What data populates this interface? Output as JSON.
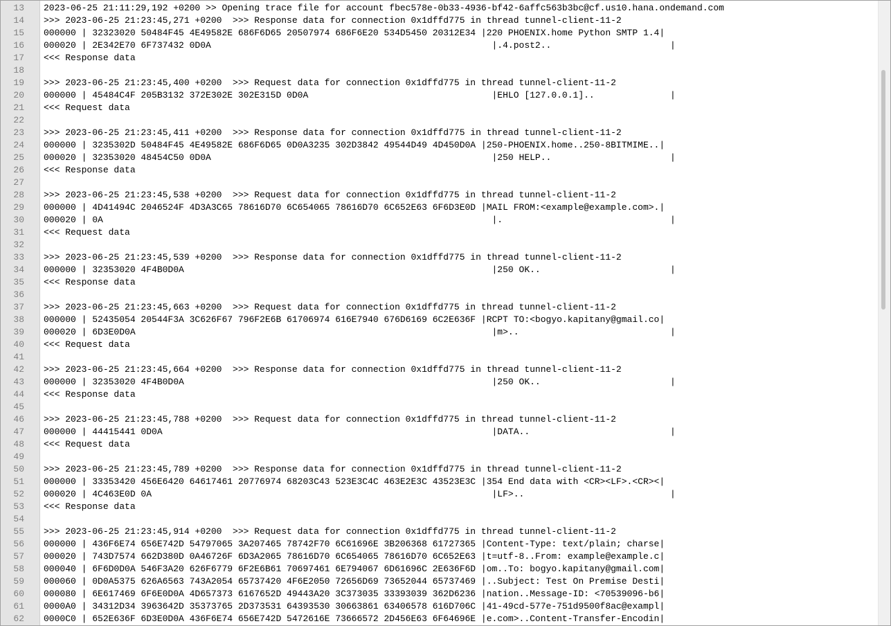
{
  "editor": {
    "lines": [
      {
        "num": "13",
        "text": "2023-06-25 21:11:29,192 +0200 >> Opening trace file for account fbec578e-0b33-4936-bf42-6affc563b3bc@cf.us10.hana.ondemand.com"
      },
      {
        "num": "14",
        "text": ">>> 2023-06-25 21:23:45,271 +0200  >>> Response data for connection 0x1dffd775 in thread tunnel-client-11-2"
      },
      {
        "num": "15",
        "text": "000000 | 32323020 50484F45 4E49582E 686F6D65 20507974 686F6E20 534D5450 20312E34 |220 PHOENIX.home Python SMTP 1.4|"
      },
      {
        "num": "16",
        "text": "000020 | 2E342E70 6F737432 0D0A                                                    |.4.post2..                      |"
      },
      {
        "num": "17",
        "text": "<<< Response data"
      },
      {
        "num": "18",
        "text": ""
      },
      {
        "num": "19",
        "text": ">>> 2023-06-25 21:23:45,400 +0200  >>> Request data for connection 0x1dffd775 in thread tunnel-client-11-2"
      },
      {
        "num": "20",
        "text": "000000 | 45484C4F 205B3132 372E302E 302E315D 0D0A                                  |EHLO [127.0.0.1]..              |"
      },
      {
        "num": "21",
        "text": "<<< Request data"
      },
      {
        "num": "22",
        "text": ""
      },
      {
        "num": "23",
        "text": ">>> 2023-06-25 21:23:45,411 +0200  >>> Response data for connection 0x1dffd775 in thread tunnel-client-11-2"
      },
      {
        "num": "24",
        "text": "000000 | 3235302D 50484F45 4E49582E 686F6D65 0D0A3235 302D3842 49544D49 4D450D0A |250-PHOENIX.home..250-8BITMIME..|"
      },
      {
        "num": "25",
        "text": "000020 | 32353020 48454C50 0D0A                                                    |250 HELP..                      |"
      },
      {
        "num": "26",
        "text": "<<< Response data"
      },
      {
        "num": "27",
        "text": ""
      },
      {
        "num": "28",
        "text": ">>> 2023-06-25 21:23:45,538 +0200  >>> Request data for connection 0x1dffd775 in thread tunnel-client-11-2"
      },
      {
        "num": "29",
        "text": "000000 | 4D41494C 2046524F 4D3A3C65 78616D70 6C654065 78616D70 6C652E63 6F6D3E0D |MAIL FROM:<example@example.com>.|"
      },
      {
        "num": "30",
        "text": "000020 | 0A                                                                        |.                               |"
      },
      {
        "num": "31",
        "text": "<<< Request data"
      },
      {
        "num": "32",
        "text": ""
      },
      {
        "num": "33",
        "text": ">>> 2023-06-25 21:23:45,539 +0200  >>> Response data for connection 0x1dffd775 in thread tunnel-client-11-2"
      },
      {
        "num": "34",
        "text": "000000 | 32353020 4F4B0D0A                                                         |250 OK..                        |"
      },
      {
        "num": "35",
        "text": "<<< Response data"
      },
      {
        "num": "36",
        "text": ""
      },
      {
        "num": "37",
        "text": ">>> 2023-06-25 21:23:45,663 +0200  >>> Request data for connection 0x1dffd775 in thread tunnel-client-11-2"
      },
      {
        "num": "38",
        "text": "000000 | 52435054 20544F3A 3C626F67 796F2E6B 61706974 616E7940 676D6169 6C2E636F |RCPT TO:<bogyo.kapitany@gmail.co|"
      },
      {
        "num": "39",
        "text": "000020 | 6D3E0D0A                                                                  |m>..                            |"
      },
      {
        "num": "40",
        "text": "<<< Request data"
      },
      {
        "num": "41",
        "text": ""
      },
      {
        "num": "42",
        "text": ">>> 2023-06-25 21:23:45,664 +0200  >>> Response data for connection 0x1dffd775 in thread tunnel-client-11-2"
      },
      {
        "num": "43",
        "text": "000000 | 32353020 4F4B0D0A                                                         |250 OK..                        |"
      },
      {
        "num": "44",
        "text": "<<< Response data"
      },
      {
        "num": "45",
        "text": ""
      },
      {
        "num": "46",
        "text": ">>> 2023-06-25 21:23:45,788 +0200  >>> Request data for connection 0x1dffd775 in thread tunnel-client-11-2"
      },
      {
        "num": "47",
        "text": "000000 | 44415441 0D0A                                                             |DATA..                          |"
      },
      {
        "num": "48",
        "text": "<<< Request data"
      },
      {
        "num": "49",
        "text": ""
      },
      {
        "num": "50",
        "text": ">>> 2023-06-25 21:23:45,789 +0200  >>> Response data for connection 0x1dffd775 in thread tunnel-client-11-2"
      },
      {
        "num": "51",
        "text": "000000 | 33353420 456E6420 64617461 20776974 68203C43 523E3C4C 463E2E3C 43523E3C |354 End data with <CR><LF>.<CR><|"
      },
      {
        "num": "52",
        "text": "000020 | 4C463E0D 0A                                                               |LF>..                           |"
      },
      {
        "num": "53",
        "text": "<<< Response data"
      },
      {
        "num": "54",
        "text": ""
      },
      {
        "num": "55",
        "text": ">>> 2023-06-25 21:23:45,914 +0200  >>> Request data for connection 0x1dffd775 in thread tunnel-client-11-2"
      },
      {
        "num": "56",
        "text": "000000 | 436F6E74 656E742D 54797065 3A207465 78742F70 6C61696E 3B206368 61727365 |Content-Type: text/plain; charse|"
      },
      {
        "num": "57",
        "text": "000020 | 743D7574 662D380D 0A46726F 6D3A2065 78616D70 6C654065 78616D70 6C652E63 |t=utf-8..From: example@example.c|"
      },
      {
        "num": "58",
        "text": "000040 | 6F6D0D0A 546F3A20 626F6779 6F2E6B61 70697461 6E794067 6D61696C 2E636F6D |om..To: bogyo.kapitany@gmail.com|"
      },
      {
        "num": "59",
        "text": "000060 | 0D0A5375 626A6563 743A2054 65737420 4F6E2050 72656D69 73652044 65737469 |..Subject: Test On Premise Desti|"
      },
      {
        "num": "60",
        "text": "000080 | 6E617469 6F6E0D0A 4D657373 6167652D 49443A20 3C373035 33393039 362D6236 |nation..Message-ID: <70539096-b6|"
      },
      {
        "num": "61",
        "text": "0000A0 | 34312D34 3963642D 35373765 2D373531 64393530 30663861 63406578 616D706C |41-49cd-577e-751d9500f8ac@exampl|"
      },
      {
        "num": "62",
        "text": "0000C0 | 652E636F 6D3E0D0A 436F6E74 656E742D 5472616E 73666572 2D456E63 6F64696E |e.com>..Content-Transfer-Encodin|"
      }
    ]
  }
}
